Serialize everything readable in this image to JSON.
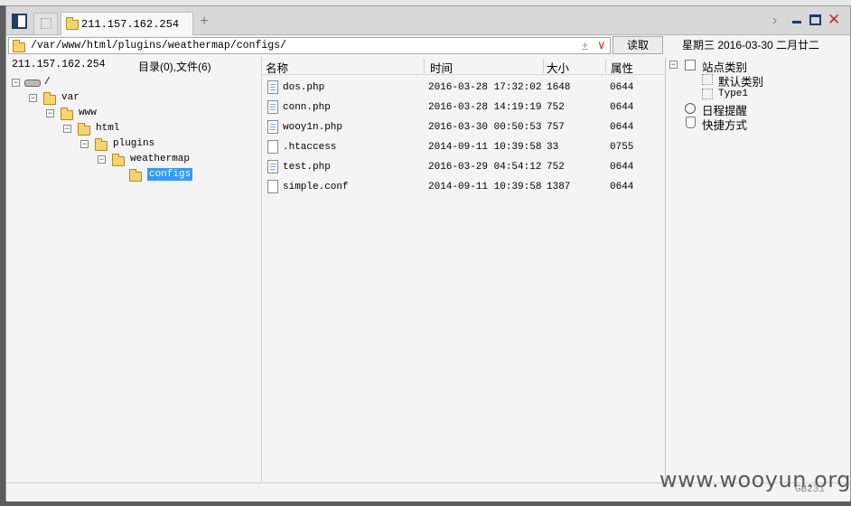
{
  "tabs": {
    "active_label": "211.157.162.254",
    "add_symbol": "+"
  },
  "window_controls": {
    "chevron": "›",
    "close": "✕"
  },
  "address_bar": {
    "path": "/var/www/html/plugins/weathermap/configs/",
    "plusminus": "±",
    "dropdown": "∨",
    "read_button": "读取"
  },
  "date_line": "星期三  2016-03-30  二月廿二",
  "left_pane": {
    "host": "211.157.162.254",
    "summary": "目录(0),文件(6)",
    "tree": [
      {
        "name": "/",
        "expander": "−",
        "icon": "drive-icon",
        "depth": 0
      },
      {
        "name": "var",
        "expander": "−",
        "icon": "folder-icon",
        "depth": 1
      },
      {
        "name": "www",
        "expander": "−",
        "icon": "folder-icon",
        "depth": 2
      },
      {
        "name": "html",
        "expander": "−",
        "icon": "folder-icon",
        "depth": 3
      },
      {
        "name": "plugins",
        "expander": "−",
        "icon": "folder-icon",
        "depth": 4
      },
      {
        "name": "weathermap",
        "expander": "−",
        "icon": "folder-icon",
        "depth": 5
      },
      {
        "name": "configs",
        "expander": "",
        "icon": "folder-open-icon",
        "depth": 6,
        "selected": true
      }
    ]
  },
  "file_list": {
    "columns": [
      "名称",
      "时间",
      "大小",
      "属性"
    ],
    "rows": [
      {
        "name": "dos.php",
        "time": "2016-03-28 17:32:02",
        "size": "1648",
        "attr": "0644",
        "type": "php"
      },
      {
        "name": "conn.php",
        "time": "2016-03-28 14:19:19",
        "size": "752",
        "attr": "0644",
        "type": "php"
      },
      {
        "name": "wooy1n.php",
        "time": "2016-03-30 00:50:53",
        "size": "757",
        "attr": "0644",
        "type": "php"
      },
      {
        "name": ".htaccess",
        "time": "2014-09-11 10:39:58",
        "size": "33",
        "attr": "0755",
        "type": "text"
      },
      {
        "name": "test.php",
        "time": "2016-03-29 04:54:12",
        "size": "752",
        "attr": "0644",
        "type": "php"
      },
      {
        "name": "simple.conf",
        "time": "2014-09-11 10:39:58",
        "size": "1387",
        "attr": "0644",
        "type": "text"
      }
    ]
  },
  "right_pane": {
    "site_category": "站点类别",
    "default_category": "默认类别",
    "type1": "Type1",
    "schedule": "日程提醒",
    "shortcuts": "快捷方式",
    "expander": "−"
  },
  "watermark": "www.wooyun.org",
  "gb_code": "GB231"
}
